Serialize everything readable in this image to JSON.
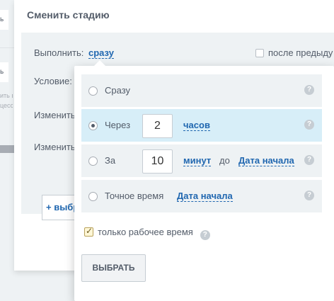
{
  "background": {
    "card1_text": "ь",
    "card2_text": "ь",
    "note_line1": "ить в",
    "note_line2": "цессо"
  },
  "dialog": {
    "title": "Сменить стадию",
    "run_label": "Выполнить:",
    "run_value": "сразу",
    "after_previous": "после предыду",
    "condition_label": "Условие:",
    "change_label_1": "Изменить",
    "change_label_2": "Изменить",
    "add_button": "+ выбра"
  },
  "popup": {
    "options": [
      {
        "label": "Сразу",
        "selected": false
      },
      {
        "label": "Через",
        "selected": true,
        "number": "2",
        "unit": "часов"
      },
      {
        "label": "За",
        "selected": false,
        "number": "10",
        "unit": "минут",
        "connector": "до",
        "target": "Дата начала"
      },
      {
        "label": "Точное время",
        "selected": false,
        "target": "Дата начала"
      }
    ],
    "help_glyph": "?",
    "work_time_only": "только рабочее время",
    "work_time_checked": true,
    "select_button": "ВЫБРАТЬ"
  },
  "colors": {
    "link": "#2067b0",
    "selected_option": "#d7eef8",
    "option_bg": "#eef2f4"
  }
}
